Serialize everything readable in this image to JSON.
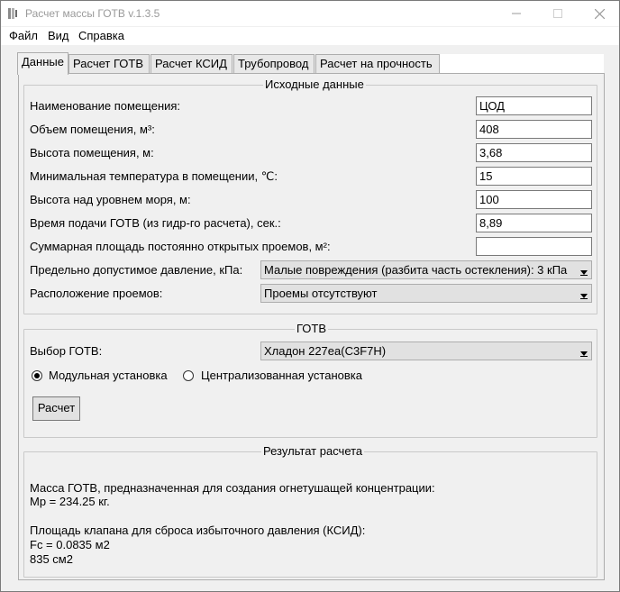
{
  "window": {
    "title": "Расчет массы ГОТВ  v.1.3.5"
  },
  "menu": [
    "Файл",
    "Вид",
    "Справка"
  ],
  "tabs": [
    "Данные",
    "Расчет ГОТВ",
    "Расчет КСИД",
    "Трубопровод",
    "Расчет на прочность"
  ],
  "active_tab": "Данные",
  "input_group": {
    "title": "Исходные данные",
    "rows": [
      {
        "label": "Наименование помещения:",
        "value": "ЦОД"
      },
      {
        "label": "Объем помещения, м³:",
        "value": "408"
      },
      {
        "label": "Высота помещения, м:",
        "value": "3,68"
      },
      {
        "label": "Минимальная температура в помещении, ℃:",
        "value": "15"
      },
      {
        "label": "Высота над уровнем моря, м:",
        "value": "100"
      },
      {
        "label": "Время подачи ГОТВ (из гидр-го расчета), сек.:",
        "value": "8,89"
      },
      {
        "label": "Суммарная площадь постоянно открытых проемов, м²:",
        "value": ""
      }
    ],
    "pressure_label": "Предельно допустимое давление, кПа:",
    "pressure_value": "Малые повреждения (разбита часть остекления): 3 кПа",
    "openings_label": "Расположение проемов:",
    "openings_value": "Проемы отсутствуют"
  },
  "agent_group": {
    "title": "ГОТВ",
    "select_label": "Выбор ГОТВ:",
    "select_value": "Хладон 227еа(C3F7H)",
    "radio_modular": "Модульная установка",
    "radio_central": "Централизованная установка",
    "selected_install": "modular",
    "calc_button": "Расчет"
  },
  "result_group": {
    "title": "Результат расчета",
    "lines": [
      "Масса ГОТВ, предназначенная для создания огнетушащей концентрации:",
      "Мр = 234.25 кг.",
      "",
      "Площадь клапана для сброса избыточного давления (КСИД):",
      "Fc = 0.0835 м2",
      "835 см2"
    ]
  }
}
